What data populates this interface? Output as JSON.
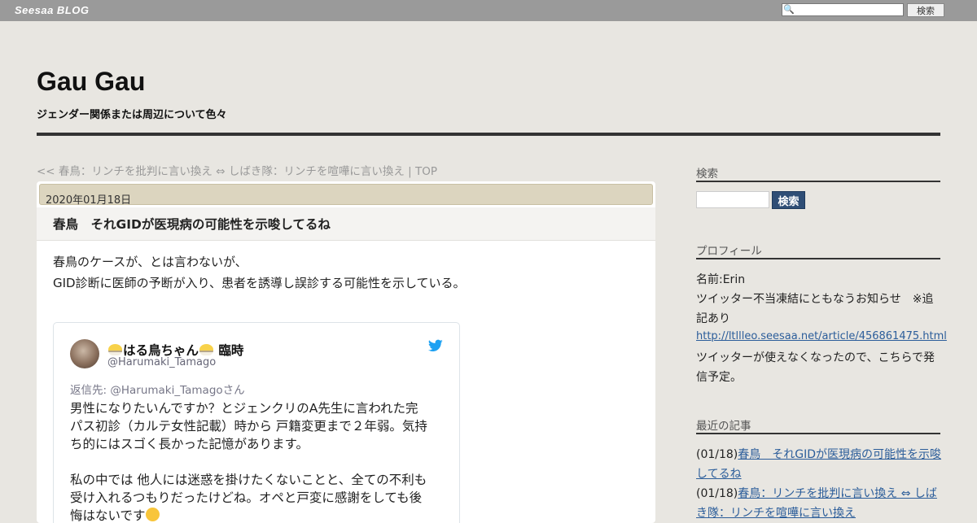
{
  "topbar": {
    "logo": "Seesaa BLOG",
    "search_placeholder": "",
    "search_button": "検索"
  },
  "header": {
    "title": "Gau Gau",
    "description": "ジェンダー関係または周辺について色々"
  },
  "nav": {
    "prev_marker": "<<",
    "prev_link": "春鳥：リンチを批判に言い換え ⇔ しばき隊：リンチを喧嘩に言い換え",
    "separator": "|",
    "top_link": "TOP"
  },
  "post": {
    "date": "2020年01月18日",
    "title": "春鳥　それGIDが医現病の可能性を示唆してるね",
    "body": [
      "春鳥のケースが、とは言わないが、",
      "GID診断に医師の予断が入り、患者を誘導し誤診する可能性を示している。"
    ],
    "tweet": {
      "name": "はる鳥ちゃん",
      "name_suffix": "臨時",
      "handle": "@Harumaki_Tamago",
      "reply_to": "返信先: @Harumaki_Tamagoさん",
      "lines": [
        "男性になりたいんですか？とジェンクリのA先生に言われた完",
        "パス初診（カルテ女性記載）時から 戸籍変更まで２年弱。気持",
        "ち的にはスゴく長かった記憶があります。",
        "私の中では 他人には迷惑を掛けたくないことと、全ての不利も",
        "受け入れるつもりだったけどね。オペと戸変に感謝をしても後",
        "悔はないです"
      ]
    }
  },
  "sidebar": {
    "search_heading": "検索",
    "search_button": "検索",
    "profile_heading": "プロフィール",
    "profile_name": "名前:Erin",
    "profile_lines": [
      "ツイッター不当凍結にともなうお知らせ　※追",
      "記あり"
    ],
    "profile_link": "http://ltllleo.seesaa.net/article/456861475.html",
    "profile_lines2": [
      "ツイッターが使えなくなったので、こちらで発",
      "信予定。"
    ],
    "recent_heading": "最近の記事",
    "recent": [
      {
        "date": "(01/18)",
        "title_l1": "春鳥　それGIDが医現病の可能性を示唆",
        "title_l2": "してるね"
      },
      {
        "date": "(01/18)",
        "title_l1": "春鳥：リンチを批判に言い換え ⇔ しば",
        "title_l2": "き隊：リンチを喧嘩に言い換え"
      }
    ]
  },
  "colors": {
    "topbar": "#9a9a9a",
    "page_bg": "#e8e6e1",
    "date_bar": "#dcd5bf",
    "link": "#2b5d9a",
    "side_button": "#2f4e76",
    "twitter_blue": "#1da1f2"
  }
}
